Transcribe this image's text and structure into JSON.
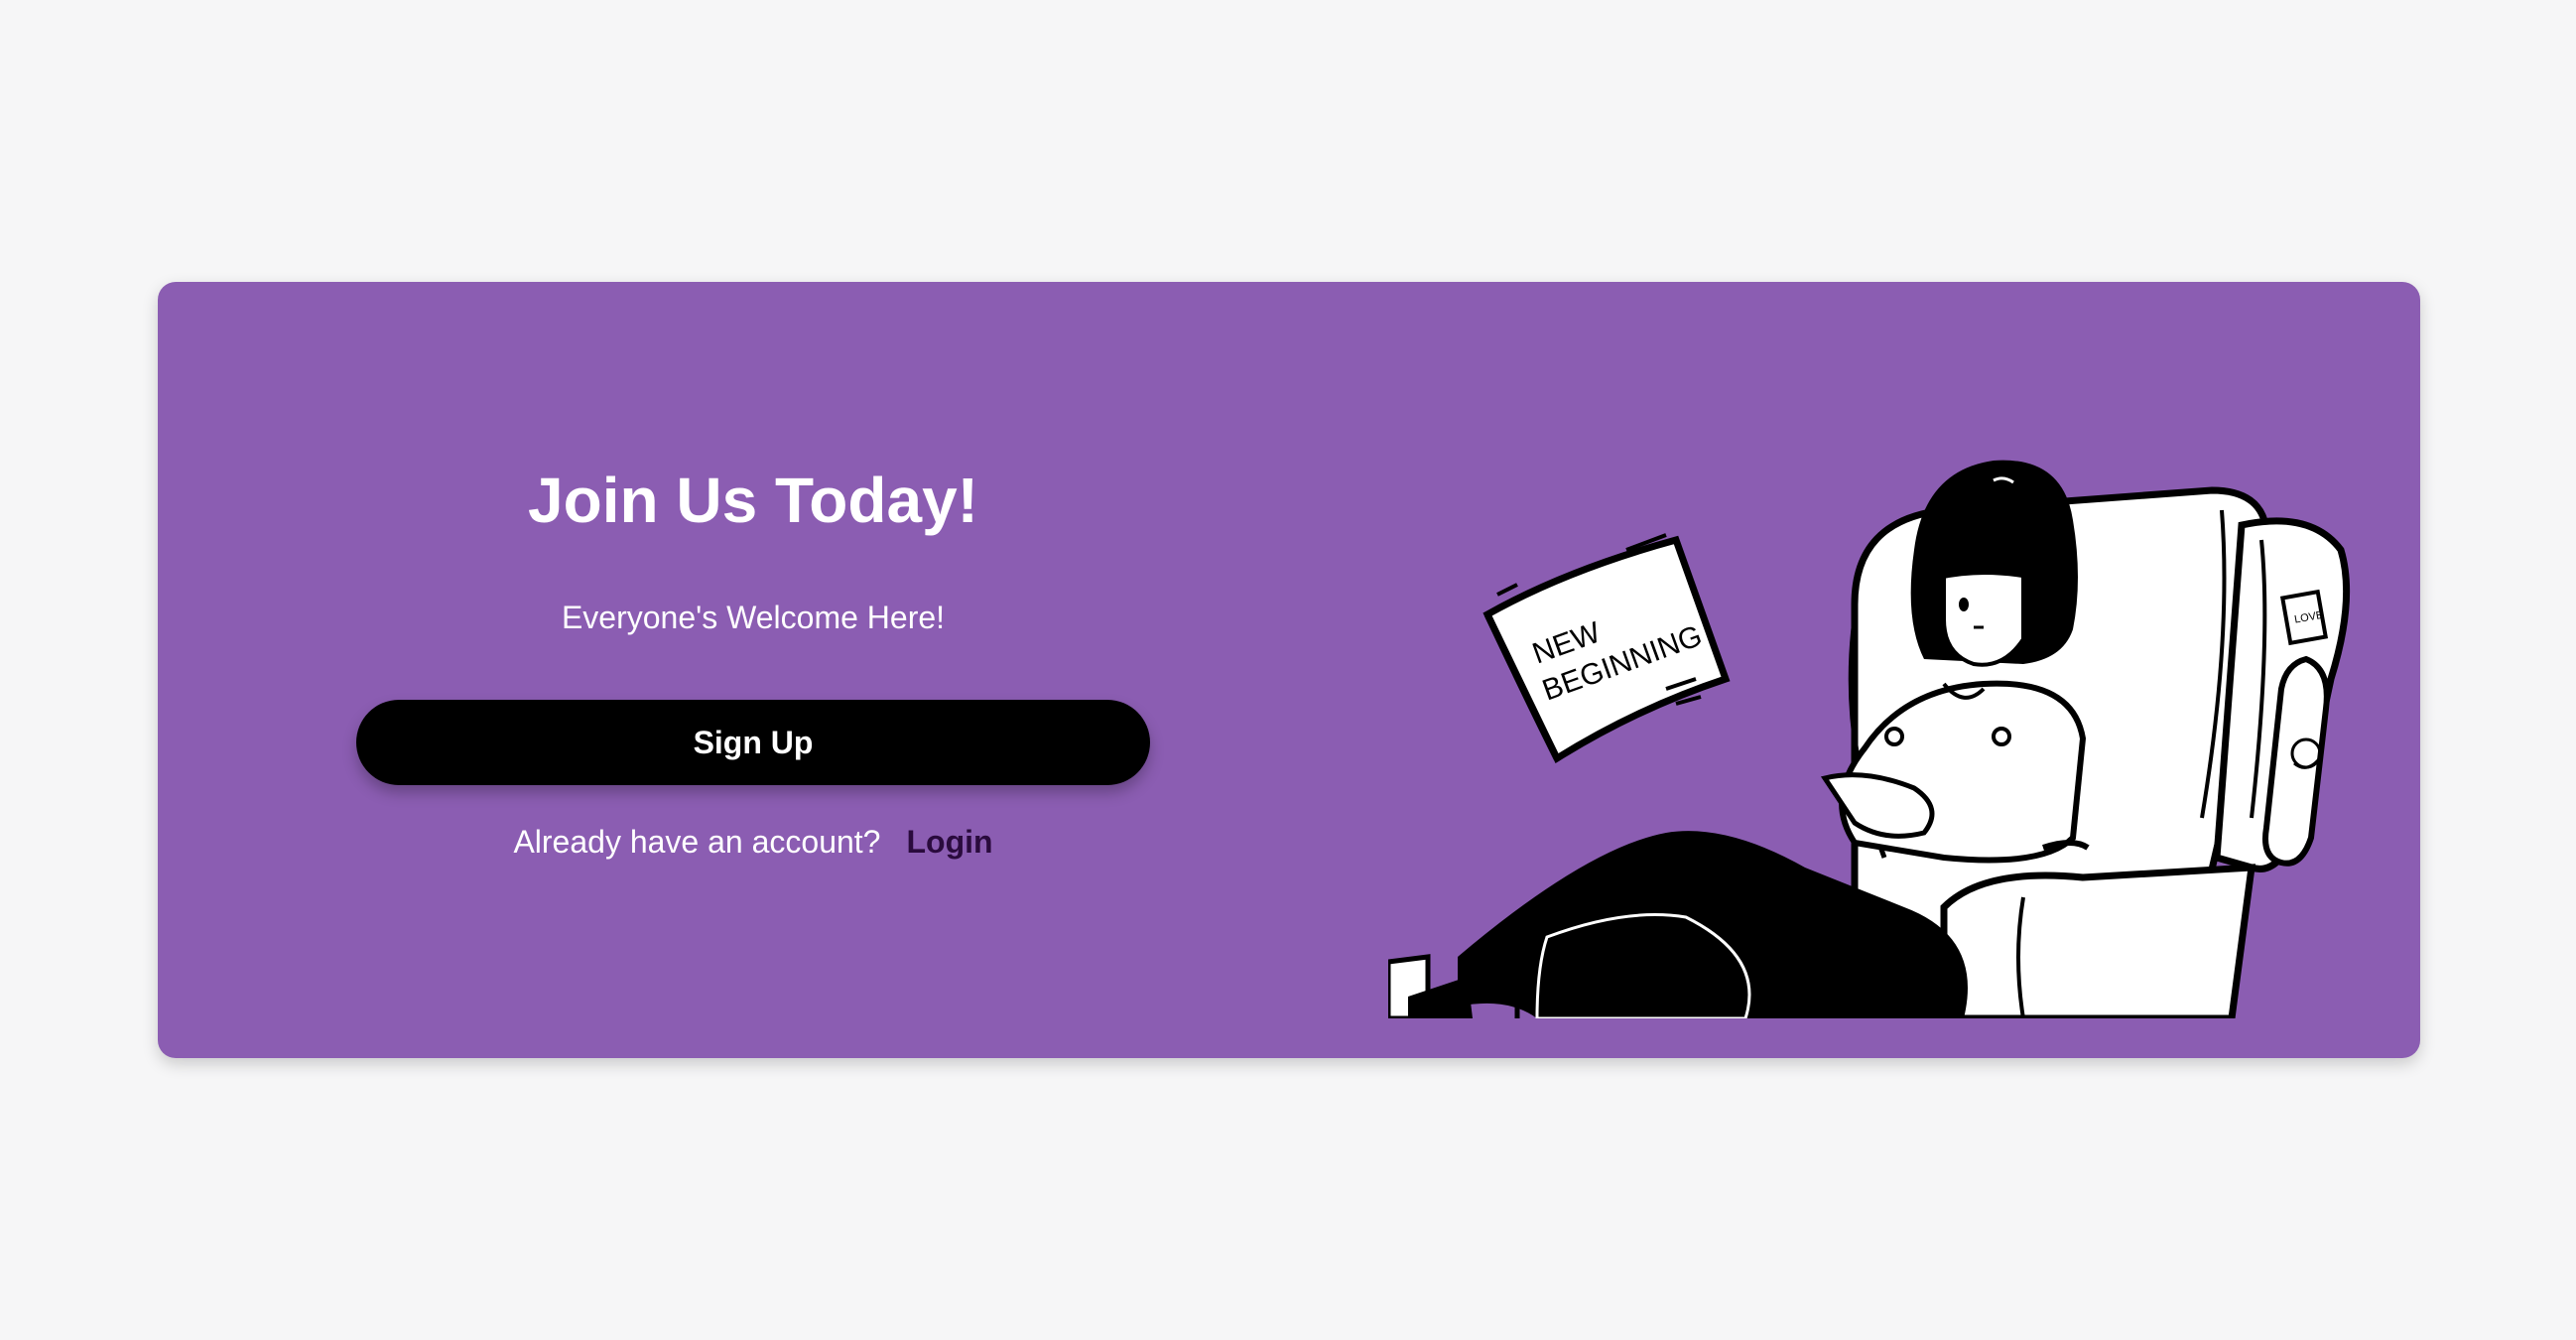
{
  "card": {
    "title": "Join Us Today!",
    "subtitle": "Everyone's Welcome Here!",
    "signup_label": "Sign Up",
    "already_text": "Already have an account?",
    "login_label": "Login"
  },
  "illustration": {
    "book_line1": "NEW",
    "book_line2": "BEGINNING",
    "tag_text": "LOVE"
  },
  "colors": {
    "background": "#f6f6f7",
    "card": "#8b5db2",
    "button": "#000000",
    "login_link": "#2a0b3d"
  }
}
